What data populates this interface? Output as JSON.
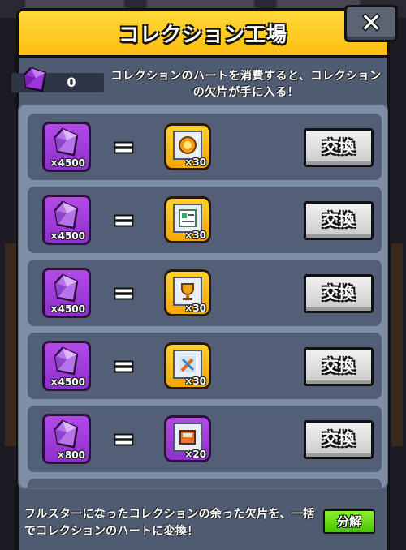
{
  "window": {
    "title": "コレクション工場",
    "close_label": "✕"
  },
  "hearts": {
    "count": "0",
    "icon": "purple-heart-gem-icon"
  },
  "info_text": "コレクションのハートを消費すると、コレクションの欠片が手に入る！",
  "rows": [
    {
      "cost": "×4500",
      "reward_qty": "×30",
      "reward_frame": "gold",
      "reward_icon": "clock-medal-icon",
      "button": "交換"
    },
    {
      "cost": "×4500",
      "reward_qty": "×30",
      "reward_frame": "gold",
      "reward_icon": "document-card-icon",
      "button": "交換"
    },
    {
      "cost": "×4500",
      "reward_qty": "×30",
      "reward_frame": "gold",
      "reward_icon": "trophy-icon",
      "button": "交換"
    },
    {
      "cost": "×4500",
      "reward_qty": "×30",
      "reward_frame": "gold",
      "reward_icon": "tools-icon",
      "button": "交換"
    },
    {
      "cost": "×800",
      "reward_qty": "×20",
      "reward_frame": "purple",
      "reward_icon": "book-icon",
      "button": "交換"
    }
  ],
  "footer": {
    "text": "フルスターになったコレクションの余った欠片を、一括でコレクションのハートに変換！",
    "button": "分解"
  },
  "colors": {
    "title_bar": "#ffc61a",
    "panel": "#4e5b71",
    "list_bg": "#7e8ea5",
    "row_bg": "#525f77",
    "gem": "#9b36d8",
    "breakdown_button": "#5fd60e"
  }
}
